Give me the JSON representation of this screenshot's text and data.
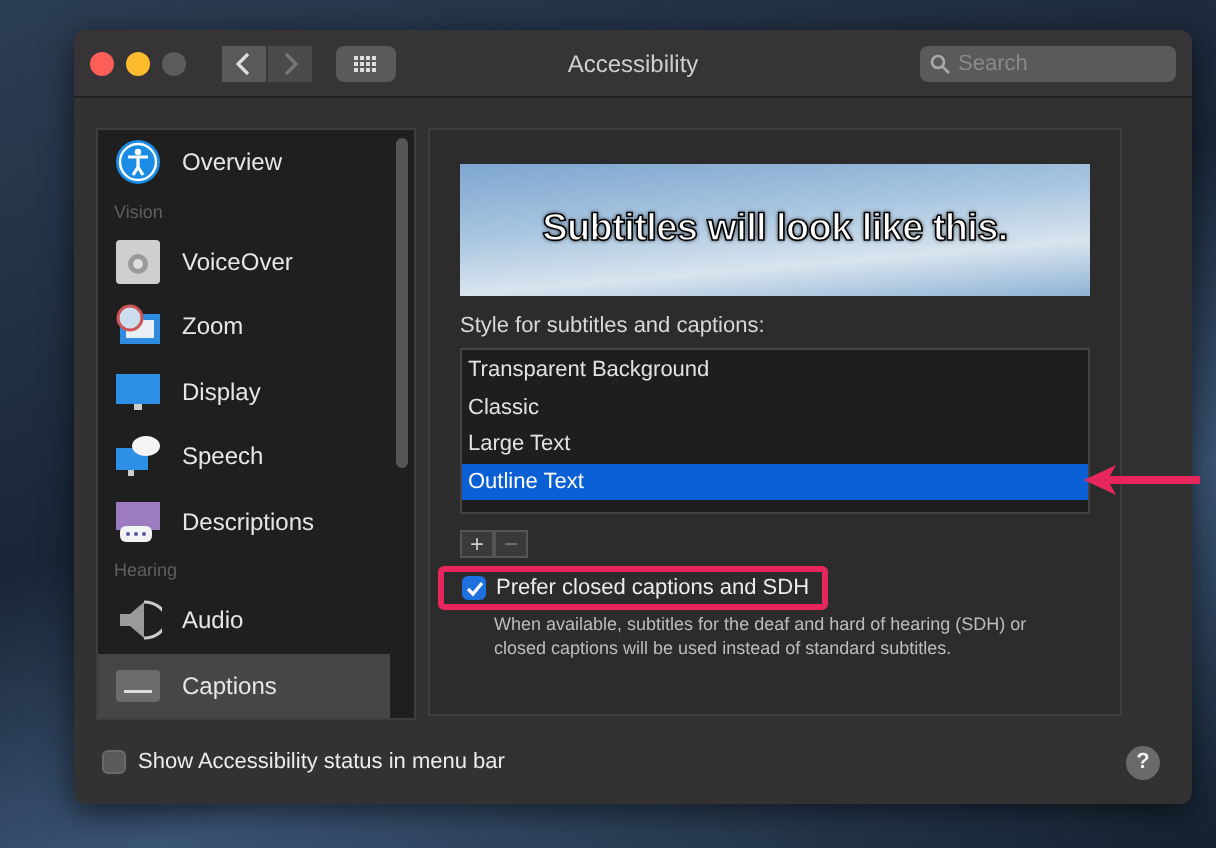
{
  "window": {
    "title": "Accessibility"
  },
  "toolbar": {
    "nav": [
      {
        "disabled": false
      },
      {
        "disabled": true
      }
    ],
    "search": {
      "placeholder": "Search"
    }
  },
  "sidebar": {
    "items": [
      {
        "kind": "item",
        "label": "Overview",
        "selected": false
      },
      {
        "kind": "header",
        "label": "Vision"
      },
      {
        "kind": "item",
        "label": "VoiceOver",
        "selected": false
      },
      {
        "kind": "item",
        "label": "Zoom",
        "selected": false
      },
      {
        "kind": "item",
        "label": "Display",
        "selected": false
      },
      {
        "kind": "item",
        "label": "Speech",
        "selected": false
      },
      {
        "kind": "item",
        "label": "Descriptions",
        "selected": false
      },
      {
        "kind": "header",
        "label": "Hearing"
      },
      {
        "kind": "item",
        "label": "Audio",
        "selected": false
      },
      {
        "kind": "item",
        "label": "Captions",
        "selected": true
      }
    ]
  },
  "captions": {
    "preview_text": "Subtitles will look like this.",
    "style_label": "Style for subtitles and captions:",
    "styles": [
      {
        "label": "Transparent Background",
        "selected": false
      },
      {
        "label": "Classic",
        "selected": false
      },
      {
        "label": "Large Text",
        "selected": false
      },
      {
        "label": "Outline Text",
        "selected": true
      }
    ],
    "add_button": "+",
    "remove_button": "−",
    "prefer_sdh": {
      "label": "Prefer closed captions and SDH",
      "checked": true,
      "description": "When available, subtitles for the deaf and hard of hearing (SDH) or closed captions will be used instead of standard subtitles."
    }
  },
  "footer": {
    "show_status": {
      "label": "Show Accessibility status in menu bar",
      "checked": false
    },
    "help": "?"
  }
}
